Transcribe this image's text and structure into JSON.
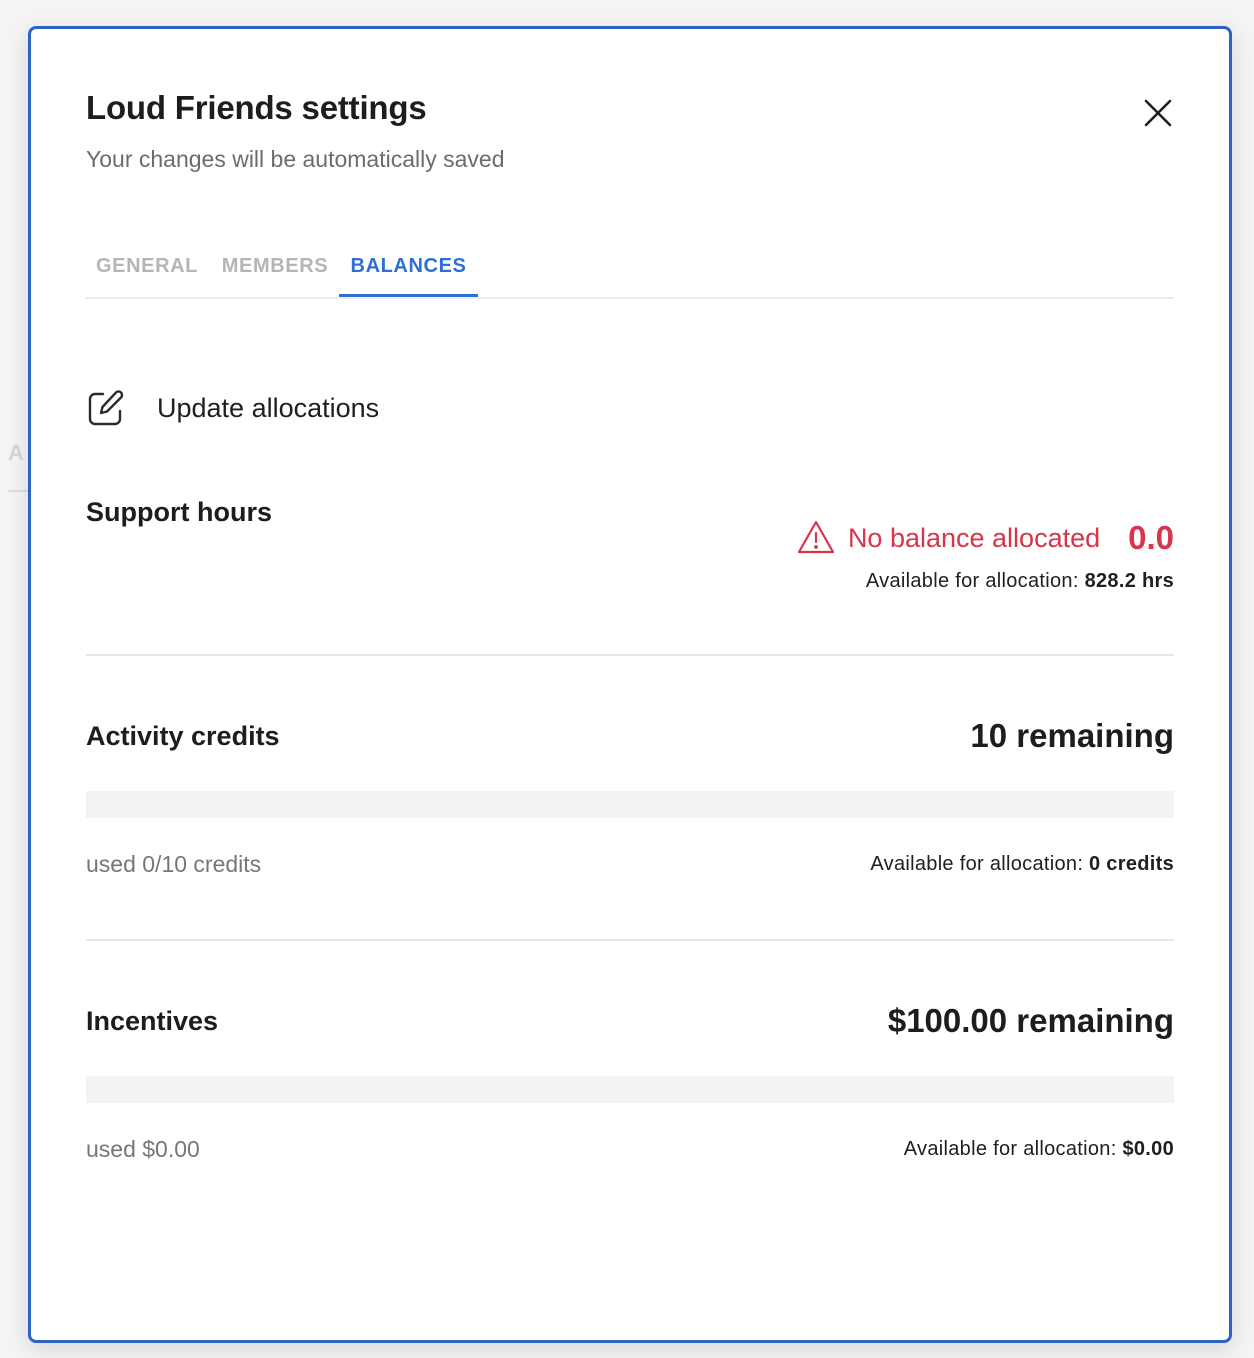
{
  "backdrop": {
    "tab_letter": "A"
  },
  "dialog": {
    "title": "Loud Friends settings",
    "subtitle": "Your changes will be automatically saved",
    "close_icon": "close-icon"
  },
  "tabs": [
    {
      "label": "GENERAL",
      "active": false
    },
    {
      "label": "MEMBERS",
      "active": false
    },
    {
      "label": "BALANCES",
      "active": true
    }
  ],
  "update_allocations": {
    "label": "Update allocations",
    "icon": "edit-icon"
  },
  "support_hours": {
    "title": "Support hours",
    "warning_icon": "warning-icon",
    "warning_text": "No balance allocated",
    "value": "0.0",
    "available_label": "Available for allocation:",
    "available_value": "828.2 hrs"
  },
  "activity_credits": {
    "title": "Activity credits",
    "remaining": "10 remaining",
    "used_fraction": 0,
    "used_text": "used 0/10 credits",
    "available_label": "Available for allocation:",
    "available_value": "0 credits"
  },
  "incentives": {
    "title": "Incentives",
    "remaining": "$100.00 remaining",
    "used_fraction": 0,
    "used_text": "used $0.00",
    "available_label": "Available for allocation:",
    "available_value": "$0.00"
  },
  "colors": {
    "accent": "#2f6fd4",
    "warning": "#d8344a",
    "modal_border": "#2f63c3"
  }
}
